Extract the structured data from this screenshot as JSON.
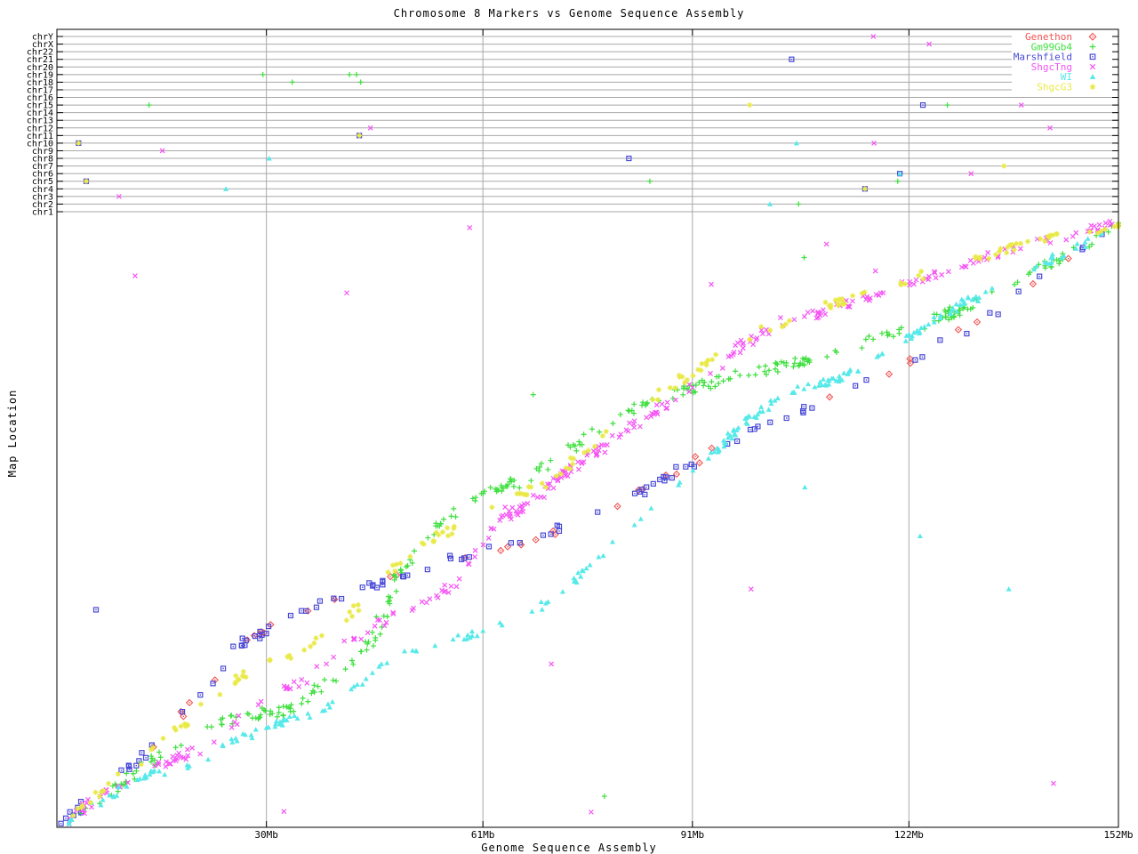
{
  "chart_data": {
    "type": "scatter",
    "title": "Chromosome 8 Markers vs Genome Sequence Assembly",
    "xlabel": "Genome Sequence Assembly",
    "ylabel": "Map Location",
    "xlim": [
      0,
      152
    ],
    "x_unit": "Mb",
    "x_ticks": [
      {
        "label": "30Mb",
        "value": 30
      },
      {
        "label": "61Mb",
        "value": 61
      },
      {
        "label": "91Mb",
        "value": 91
      },
      {
        "label": "122Mb",
        "value": 122
      },
      {
        "label": "152Mb",
        "value": 152
      }
    ],
    "grid": "vertical gridlines at x ticks; horizontal gray lane lines for each chromosome",
    "legend_position": "top-right",
    "frame_color": "#000000",
    "grid_color": "#a8a8a8",
    "chromosome_lanes_top_to_bottom": [
      "chrY",
      "chrX",
      "chr22",
      "chr21",
      "chr20",
      "chr19",
      "chr18",
      "chr17",
      "chr16",
      "chr15",
      "chr14",
      "chr13",
      "chr12",
      "chr11",
      "chr10",
      "chr9",
      "chr8",
      "chr7",
      "chr6",
      "chr5",
      "chr4",
      "chr3",
      "chr2",
      "chr1"
    ],
    "seed": 1337,
    "series": [
      {
        "name": "Genethon",
        "color": "#f25252",
        "marker": "diamond-dot",
        "count": 34,
        "cluster_p": 0.3,
        "cluster_max": 2,
        "jx": 1.6,
        "jy": 0.012,
        "path": [
          [
            1,
            0.01
          ],
          [
            7,
            0.07
          ],
          [
            14,
            0.135
          ],
          [
            21,
            0.22
          ],
          [
            26,
            0.3
          ],
          [
            31,
            0.33
          ],
          [
            36,
            0.357
          ],
          [
            41,
            0.38
          ],
          [
            46,
            0.4
          ],
          [
            52,
            0.42
          ],
          [
            58,
            0.445
          ],
          [
            64,
            0.46
          ],
          [
            70,
            0.48
          ],
          [
            78,
            0.52
          ],
          [
            86,
            0.565
          ],
          [
            94,
            0.62
          ],
          [
            101,
            0.66
          ],
          [
            108,
            0.69
          ],
          [
            114,
            0.72
          ],
          [
            120,
            0.75
          ],
          [
            126,
            0.79
          ],
          [
            132,
            0.83
          ],
          [
            138,
            0.875
          ],
          [
            144,
            0.925
          ],
          [
            149,
            0.965
          ],
          [
            152,
            0.985
          ]
        ]
      },
      {
        "name": "Gm99Gb4",
        "color": "#3fdf3f",
        "marker": "plus",
        "count": 150,
        "cluster_p": 0.55,
        "cluster_max": 5,
        "jx": 1.2,
        "jy": 0.018,
        "path": [
          [
            1,
            0.005
          ],
          [
            8,
            0.06
          ],
          [
            14,
            0.11
          ],
          [
            20,
            0.16
          ],
          [
            27,
            0.185
          ],
          [
            33,
            0.19
          ],
          [
            39,
            0.24
          ],
          [
            45,
            0.3
          ],
          [
            49,
            0.42
          ],
          [
            54,
            0.49
          ],
          [
            60,
            0.54
          ],
          [
            68,
            0.575
          ],
          [
            75,
            0.63
          ],
          [
            82,
            0.685
          ],
          [
            89,
            0.715
          ],
          [
            96,
            0.735
          ],
          [
            103,
            0.755
          ],
          [
            110,
            0.775
          ],
          [
            117,
            0.8
          ],
          [
            124,
            0.825
          ],
          [
            131,
            0.86
          ],
          [
            138,
            0.9
          ],
          [
            144,
            0.935
          ],
          [
            149,
            0.97
          ],
          [
            152,
            0.99
          ]
        ]
      },
      {
        "name": "Marshfield",
        "color": "#4949d8",
        "marker": "square-dot",
        "count": 72,
        "cluster_p": 0.4,
        "cluster_max": 3,
        "jx": 1.5,
        "jy": 0.015,
        "path": [
          [
            1,
            0.01
          ],
          [
            7,
            0.07
          ],
          [
            14,
            0.135
          ],
          [
            21,
            0.22
          ],
          [
            26,
            0.3
          ],
          [
            31,
            0.33
          ],
          [
            36,
            0.357
          ],
          [
            41,
            0.38
          ],
          [
            46,
            0.4
          ],
          [
            52,
            0.42
          ],
          [
            58,
            0.445
          ],
          [
            64,
            0.46
          ],
          [
            70,
            0.48
          ],
          [
            78,
            0.52
          ],
          [
            86,
            0.565
          ],
          [
            94,
            0.62
          ],
          [
            101,
            0.66
          ],
          [
            108,
            0.69
          ],
          [
            114,
            0.72
          ],
          [
            120,
            0.75
          ],
          [
            126,
            0.79
          ],
          [
            132,
            0.83
          ],
          [
            138,
            0.875
          ],
          [
            144,
            0.925
          ],
          [
            149,
            0.965
          ],
          [
            152,
            0.985
          ]
        ]
      },
      {
        "name": "ShgcTng",
        "color": "#f553f5",
        "marker": "cross",
        "count": 150,
        "cluster_p": 0.55,
        "cluster_max": 5,
        "jx": 1.2,
        "jy": 0.015,
        "path": [
          [
            1,
            0.01
          ],
          [
            8,
            0.065
          ],
          [
            14,
            0.1
          ],
          [
            20,
            0.125
          ],
          [
            26,
            0.18
          ],
          [
            31,
            0.215
          ],
          [
            36,
            0.245
          ],
          [
            41,
            0.3
          ],
          [
            46,
            0.335
          ],
          [
            51,
            0.36
          ],
          [
            56,
            0.39
          ],
          [
            60,
            0.45
          ],
          [
            63,
            0.5
          ],
          [
            68,
            0.535
          ],
          [
            74,
            0.59
          ],
          [
            80,
            0.64
          ],
          [
            86,
            0.685
          ],
          [
            92,
            0.73
          ],
          [
            98,
            0.79
          ],
          [
            104,
            0.83
          ],
          [
            110,
            0.845
          ],
          [
            116,
            0.87
          ],
          [
            122,
            0.895
          ],
          [
            128,
            0.915
          ],
          [
            134,
            0.94
          ],
          [
            141,
            0.96
          ],
          [
            147,
            0.975
          ],
          [
            152,
            0.995
          ]
        ]
      },
      {
        "name": "WI",
        "color": "#57e9e9",
        "marker": "triangle-filled",
        "count": 125,
        "cluster_p": 0.5,
        "cluster_max": 5,
        "jx": 1.0,
        "jy": 0.012,
        "path": [
          [
            1,
            0.005
          ],
          [
            7,
            0.05
          ],
          [
            13,
            0.085
          ],
          [
            19,
            0.1
          ],
          [
            25,
            0.14
          ],
          [
            31,
            0.17
          ],
          [
            37,
            0.185
          ],
          [
            43,
            0.235
          ],
          [
            49,
            0.285
          ],
          [
            55,
            0.305
          ],
          [
            61,
            0.32
          ],
          [
            67,
            0.345
          ],
          [
            73,
            0.39
          ],
          [
            80,
            0.475
          ],
          [
            87,
            0.54
          ],
          [
            94,
            0.615
          ],
          [
            100,
            0.68
          ],
          [
            106,
            0.72
          ],
          [
            112,
            0.735
          ],
          [
            118,
            0.775
          ],
          [
            124,
            0.82
          ],
          [
            130,
            0.86
          ],
          [
            136,
            0.895
          ],
          [
            142,
            0.93
          ],
          [
            148,
            0.965
          ],
          [
            152,
            0.99
          ]
        ]
      },
      {
        "name": "ShgcG3",
        "color": "#e9e947",
        "marker": "asterisk",
        "count": 95,
        "cluster_p": 0.5,
        "cluster_max": 4,
        "jx": 1.2,
        "jy": 0.015,
        "path": [
          [
            1,
            0.01
          ],
          [
            8,
            0.07
          ],
          [
            15,
            0.14
          ],
          [
            22,
            0.21
          ],
          [
            28,
            0.26
          ],
          [
            34,
            0.285
          ],
          [
            40,
            0.33
          ],
          [
            46,
            0.4
          ],
          [
            52,
            0.46
          ],
          [
            58,
            0.5
          ],
          [
            64,
            0.53
          ],
          [
            70,
            0.565
          ],
          [
            76,
            0.62
          ],
          [
            83,
            0.68
          ],
          [
            90,
            0.74
          ],
          [
            97,
            0.79
          ],
          [
            104,
            0.83
          ],
          [
            110,
            0.855
          ],
          [
            116,
            0.875
          ],
          [
            122,
            0.9
          ],
          [
            128,
            0.92
          ],
          [
            135,
            0.945
          ],
          [
            142,
            0.965
          ],
          [
            148,
            0.98
          ],
          [
            152,
            0.99
          ]
        ]
      }
    ],
    "lane_outliers": [
      {
        "chr": "chrY",
        "x": 116.9,
        "series": "ShgcTng"
      },
      {
        "chr": "chrX",
        "x": 124.9,
        "series": "ShgcTng"
      },
      {
        "chr": "chr21",
        "x": 105.2,
        "series": "Marshfield"
      },
      {
        "chr": "chr19",
        "x": 29.5,
        "series": "Gm99Gb4"
      },
      {
        "chr": "chr19",
        "x": 41.9,
        "series": "Gm99Gb4"
      },
      {
        "chr": "chr19",
        "x": 42.9,
        "series": "Gm99Gb4"
      },
      {
        "chr": "chr18",
        "x": 33.7,
        "series": "Gm99Gb4"
      },
      {
        "chr": "chr18",
        "x": 43.5,
        "series": "Gm99Gb4"
      },
      {
        "chr": "chr15",
        "x": 13.2,
        "series": "Gm99Gb4"
      },
      {
        "chr": "chr15",
        "x": 99.2,
        "series": "ShgcG3"
      },
      {
        "chr": "chr15",
        "x": 124.0,
        "series": "Marshfield"
      },
      {
        "chr": "chr15",
        "x": 127.5,
        "series": "Gm99Gb4"
      },
      {
        "chr": "chr15",
        "x": 138.1,
        "series": "ShgcTng"
      },
      {
        "chr": "chr12",
        "x": 44.9,
        "series": "ShgcTng"
      },
      {
        "chr": "chr12",
        "x": 142.2,
        "series": "ShgcTng"
      },
      {
        "chr": "chr11",
        "x": 43.3,
        "series": "Marshfield"
      },
      {
        "chr": "chr11",
        "x": 43.3,
        "series": "ShgcG3"
      },
      {
        "chr": "chr10",
        "x": 3.1,
        "series": "Marshfield"
      },
      {
        "chr": "chr10",
        "x": 3.1,
        "series": "ShgcG3"
      },
      {
        "chr": "chr10",
        "x": 105.9,
        "series": "WI"
      },
      {
        "chr": "chr10",
        "x": 117.0,
        "series": "ShgcTng"
      },
      {
        "chr": "chr9",
        "x": 15.1,
        "series": "ShgcTng"
      },
      {
        "chr": "chr8",
        "x": 30.4,
        "series": "WI"
      },
      {
        "chr": "chr8",
        "x": 81.9,
        "series": "Marshfield"
      },
      {
        "chr": "chr7",
        "x": 135.6,
        "series": "ShgcG3"
      },
      {
        "chr": "chr6",
        "x": 120.7,
        "series": "Marshfield"
      },
      {
        "chr": "chr6",
        "x": 120.7,
        "series": "WI"
      },
      {
        "chr": "chr6",
        "x": 130.9,
        "series": "ShgcTng"
      },
      {
        "chr": "chr5",
        "x": 4.2,
        "series": "Marshfield"
      },
      {
        "chr": "chr5",
        "x": 4.2,
        "series": "ShgcG3"
      },
      {
        "chr": "chr5",
        "x": 84.9,
        "series": "Gm99Gb4"
      },
      {
        "chr": "chr5",
        "x": 120.4,
        "series": "Gm99Gb4"
      },
      {
        "chr": "chr4",
        "x": 24.2,
        "series": "WI"
      },
      {
        "chr": "chr4",
        "x": 115.7,
        "series": "Marshfield"
      },
      {
        "chr": "chr4",
        "x": 115.7,
        "series": "ShgcG3"
      },
      {
        "chr": "chr3",
        "x": 8.9,
        "series": "ShgcTng"
      },
      {
        "chr": "chr2",
        "x": 102.1,
        "series": "WI"
      },
      {
        "chr": "chr2",
        "x": 106.2,
        "series": "Gm99Gb4"
      }
    ],
    "area_outliers": [
      {
        "x": 11.2,
        "y": 0.905,
        "series": "ShgcTng"
      },
      {
        "x": 41.5,
        "y": 0.877,
        "series": "ShgcTng"
      },
      {
        "x": 59.1,
        "y": 0.984,
        "series": "ShgcTng"
      },
      {
        "x": 32.5,
        "y": 0.026,
        "series": "ShgcTng"
      },
      {
        "x": 76.5,
        "y": 0.025,
        "series": "ShgcTng"
      },
      {
        "x": 93.7,
        "y": 0.891,
        "series": "ShgcTng"
      },
      {
        "x": 99.4,
        "y": 0.391,
        "series": "ShgcTng"
      },
      {
        "x": 110.2,
        "y": 0.957,
        "series": "ShgcTng"
      },
      {
        "x": 117.2,
        "y": 0.913,
        "series": "ShgcTng"
      },
      {
        "x": 142.7,
        "y": 0.072,
        "series": "ShgcTng"
      },
      {
        "x": 70.8,
        "y": 0.268,
        "series": "ShgcTng"
      },
      {
        "x": 5.6,
        "y": 0.357,
        "series": "Marshfield"
      },
      {
        "x": 107.1,
        "y": 0.558,
        "series": "WI"
      },
      {
        "x": 123.6,
        "y": 0.478,
        "series": "WI"
      },
      {
        "x": 136.3,
        "y": 0.391,
        "series": "WI"
      },
      {
        "x": 78.4,
        "y": 0.051,
        "series": "Gm99Gb4"
      },
      {
        "x": 68.2,
        "y": 0.71,
        "series": "Gm99Gb4"
      },
      {
        "x": 107.0,
        "y": 0.935,
        "series": "Gm99Gb4"
      }
    ]
  }
}
